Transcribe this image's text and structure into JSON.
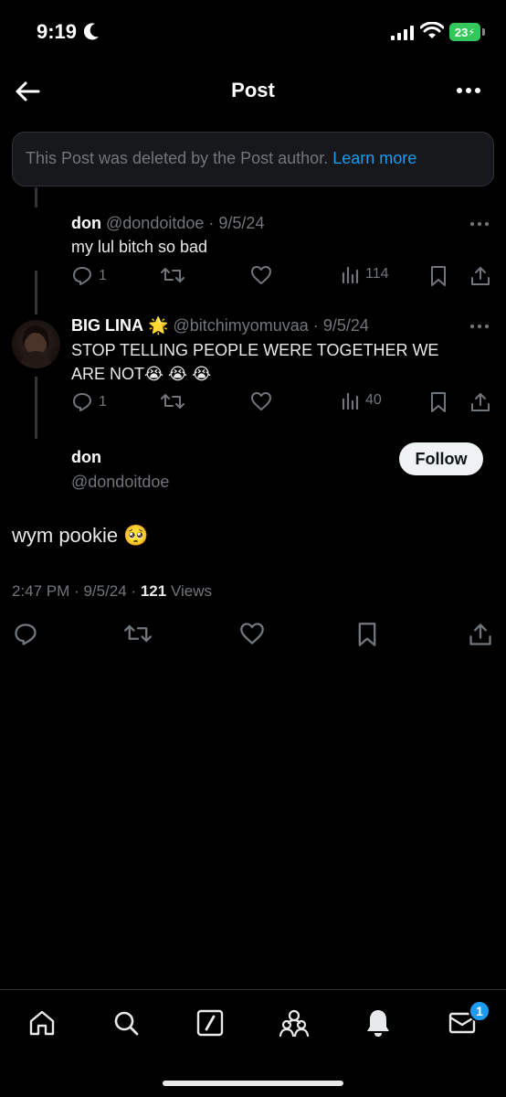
{
  "status_bar": {
    "time": "9:19",
    "battery": "23"
  },
  "header": {
    "title": "Post"
  },
  "deleted_notice": {
    "text": "This Post was deleted by the Post author.",
    "link": "Learn more"
  },
  "replies": [
    {
      "name": "don",
      "handle": "@dondoitdoe",
      "date": "9/5/24",
      "text": "my lul bitch so bad",
      "reply_count": "1",
      "views": "114"
    },
    {
      "name": "BIG LINA",
      "name_emoji": "🌟",
      "handle": "@bitchimyomuvaa",
      "date": "9/5/24",
      "text": "STOP TELLING PEOPLE WERE TOGETHER WE ARE NOT😭 😭 😭",
      "reply_count": "1",
      "views": "40"
    }
  ],
  "main_post": {
    "name": "don",
    "handle": "@dondoitdoe",
    "follow_label": "Follow",
    "text": "wym pookie 🥺",
    "time": "2:47 PM",
    "date": "9/5/24",
    "views_count": "121",
    "views_label": "Views"
  },
  "tabbar": {
    "messages_badge": "1"
  },
  "colors": {
    "accent": "#1d9bf0",
    "muted": "#71767b",
    "background": "#000000"
  }
}
